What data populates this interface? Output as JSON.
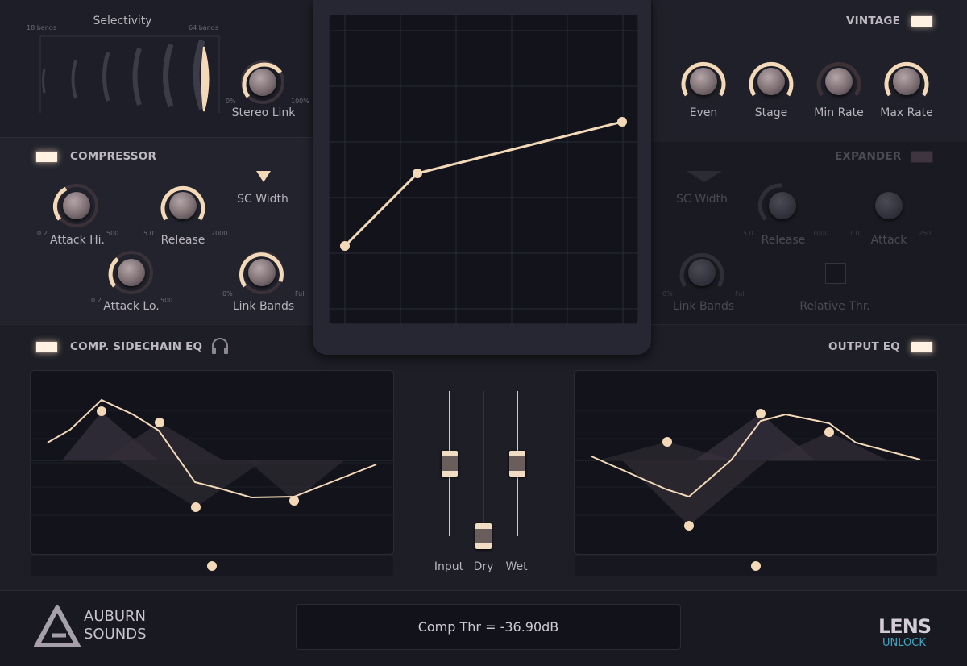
{
  "selectivity": {
    "title": "Selectivity",
    "min_label": "18 bands",
    "max_label": "64 bands"
  },
  "stereo_link": {
    "label": "Stereo Link",
    "min": "0%",
    "max": "100%"
  },
  "vintage": {
    "title": "VINTAGE",
    "knobs": [
      "Even",
      "Stage",
      "Min Rate",
      "Max Rate"
    ]
  },
  "compressor": {
    "title": "COMPRESSOR",
    "attack_hi": {
      "label": "Attack Hi.",
      "min": "0.2",
      "max": "500"
    },
    "release": {
      "label": "Release",
      "min": "5.0",
      "max": "2000"
    },
    "sc_width": {
      "label": "SC Width"
    },
    "attack_lo": {
      "label": "Attack Lo.",
      "min": "0.2",
      "max": "500"
    },
    "link_bands": {
      "label": "Link Bands",
      "min": "0%",
      "max": "Full"
    }
  },
  "expander": {
    "title": "EXPANDER",
    "sc_width": {
      "label": "SC Width"
    },
    "release": {
      "label": "Release",
      "min": "5.0",
      "max": "1000"
    },
    "attack": {
      "label": "Attack",
      "min": "1.0",
      "max": "250"
    },
    "link_bands": {
      "label": "Link Bands",
      "min": "0%",
      "max": "Full"
    },
    "relative_thr": {
      "label": "Relative Thr."
    }
  },
  "sidechain_eq": {
    "title": "COMP. SIDECHAIN EQ"
  },
  "output_eq": {
    "title": "OUTPUT EQ"
  },
  "faders": [
    {
      "label": "Input"
    },
    {
      "label": "Dry"
    },
    {
      "label": "Wet"
    }
  ],
  "status": {
    "text": "Comp Thr = -36.90dB"
  },
  "brand": {
    "line1": "AUBURN",
    "line2": "SOUNDS"
  },
  "product": {
    "name": "LENS",
    "action": "UNLOCK"
  },
  "colors": {
    "accent": "#f5dcc0",
    "background": "#1b1c24",
    "led_on": "#fff2e2"
  }
}
